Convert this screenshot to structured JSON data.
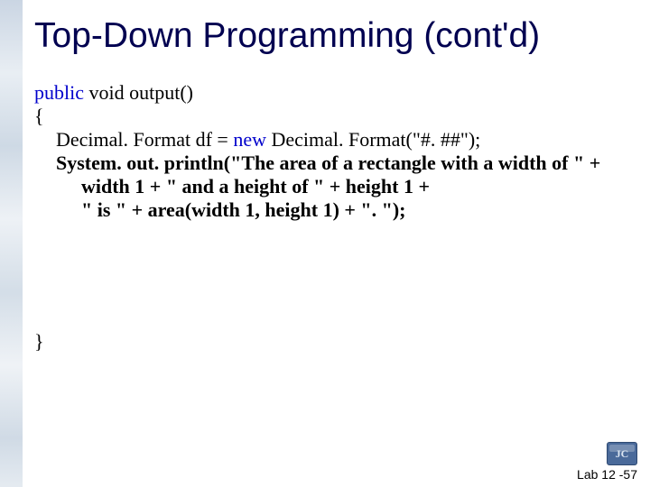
{
  "title": "Top-Down Programming (cont'd)",
  "code": {
    "sig_public": "public",
    "sig_void": " void ",
    "sig_method": "output()",
    "brace_open": "{",
    "l1_a": "Decimal. Format df = ",
    "l1_new": "new",
    "l1_b": " Decimal. Format(\"#. ##\");",
    "l2": "System. out. println(\"The area of a rectangle with a width of \" +",
    "l3": "width 1 + \" and a height of \" + height 1 +",
    "l4": "\" is \" + area(width 1, height 1) + \". \");",
    "brace_close": "}"
  },
  "badge": "JC",
  "footer": "Lab 12 -57"
}
